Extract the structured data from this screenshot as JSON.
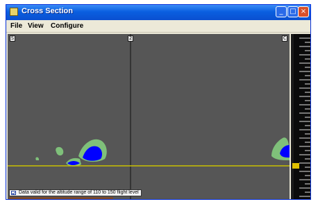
{
  "window": {
    "title": "Cross Section",
    "controls": {
      "minimize": "_",
      "maximize": "□",
      "close": "×"
    }
  },
  "menu": {
    "items": [
      {
        "label": "File"
      },
      {
        "label": "View"
      },
      {
        "label": "Configure"
      }
    ]
  },
  "view": {
    "markers": [
      "S",
      "2",
      "C"
    ],
    "status": {
      "checked": true,
      "text": "Data valid for the altitude range of 110 to 150 flight level"
    }
  },
  "colors": {
    "plot_background": "#565656",
    "cloud_outer": "#7fc07a",
    "cloud_core": "#0000ff",
    "level_line": "#c8c000",
    "vertical_line": "#111111",
    "ground": "#7b4a2a",
    "ruler_background": "#0b0b0b",
    "ruler_tick": "#e0e0e0",
    "ruler_marker": "#e0c000"
  }
}
